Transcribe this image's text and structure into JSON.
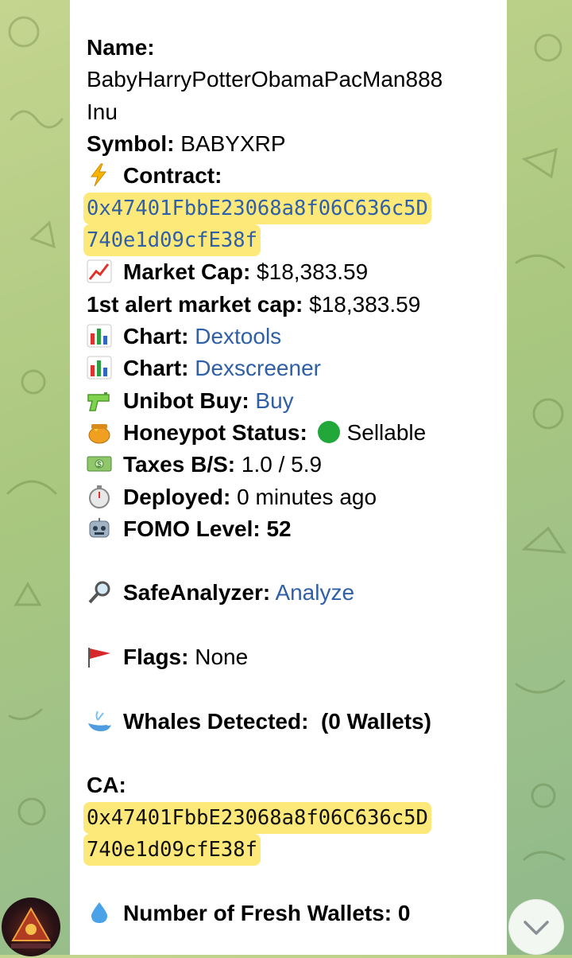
{
  "message": {
    "name_label": "Name",
    "name_value_line1": "BabyHarryPotterObamaPacMan888",
    "name_value_line2": "Inu",
    "symbol_label": "Symbol",
    "symbol_value": "BABYXRP",
    "contract_label": "Contract",
    "contract_line1": "0x47401FbbE23068a8f06C636c5D",
    "contract_line2": "740e1d09cfE38f",
    "market_cap_label": "Market Cap",
    "market_cap_value": "$18,383.59",
    "first_alert_label": "1st alert market cap",
    "first_alert_value": "$18,383.59",
    "chart1_label": "Chart",
    "chart1_link": "Dextools",
    "chart2_label": "Chart",
    "chart2_link": "Dexscreener",
    "unibot_label": "Unibot Buy",
    "unibot_link": "Buy",
    "honeypot_label": "Honeypot Status",
    "honeypot_value": "Sellable",
    "taxes_label": "Taxes B/S",
    "taxes_value": "1.0 / 5.9",
    "deployed_label": "Deployed",
    "deployed_value": "0 minutes ago",
    "fomo_label": "FOMO Level",
    "fomo_value": "52",
    "safeanalyzer_label": "SafeAnalyzer",
    "safeanalyzer_link": "Analyze",
    "flags_label": "Flags",
    "flags_value": "None",
    "whales_label": "Whales Detected",
    "whales_value": "(0 Wallets)",
    "ca_label": "CA",
    "ca_line1": "0x47401FbbE23068a8f06C636c5D",
    "ca_line2": "740e1d09cfE38f",
    "fresh_label": "Number of Fresh Wallets",
    "fresh_value": "0"
  },
  "icons": {
    "contract": "lightning-icon",
    "market_cap": "chart-increasing-icon",
    "chart": "bar-chart-icon",
    "unibot": "water-pistol-icon",
    "honeypot": "honey-pot-icon",
    "status": "green-circle-icon",
    "taxes": "dollar-banknote-icon",
    "deployed": "stopwatch-icon",
    "fomo": "robot-icon",
    "safeanalyzer": "magnifying-glass-icon",
    "flags": "red-flag-icon",
    "whales": "spouting-whale-icon",
    "fresh": "droplet-icon"
  },
  "colors": {
    "link": "#2f5fa6",
    "highlight": "#fde87a",
    "status_green": "#22a83a"
  }
}
